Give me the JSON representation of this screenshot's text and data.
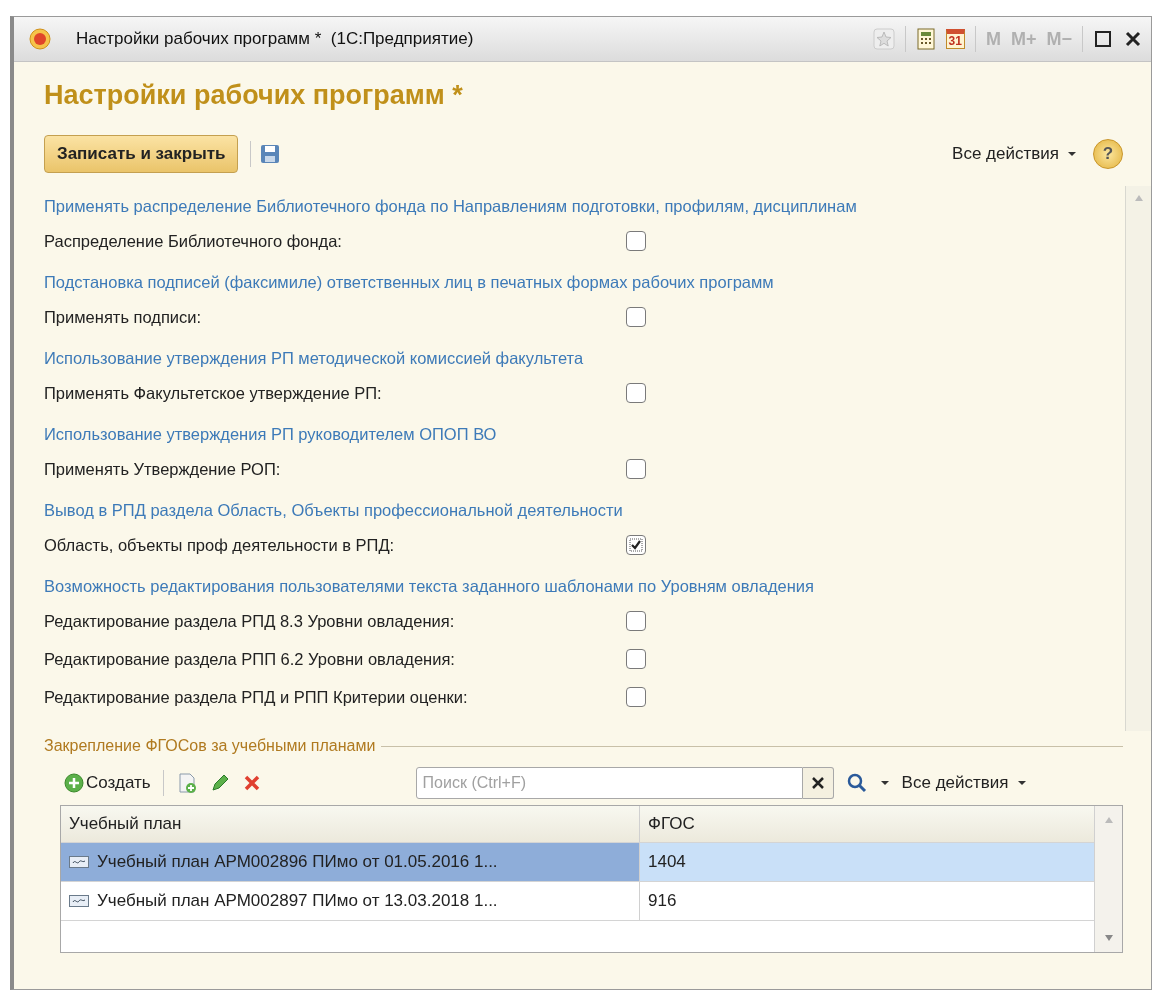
{
  "window": {
    "title": "Настройки рабочих программ *  (1С:Предприятие)",
    "calendar_day": "31",
    "memory_buttons": [
      "M",
      "M+",
      "M−"
    ]
  },
  "form": {
    "title": "Настройки рабочих программ *",
    "save_button": "Записать и закрыть",
    "all_actions": "Все действия",
    "help": "?"
  },
  "settings": [
    {
      "kind": "section",
      "text": "Применять распределение Библиотечного фонда по Направлениям подготовки, профилям, дисциплинам"
    },
    {
      "kind": "checkbox",
      "label": "Распределение Библиотечного фонда:",
      "checked": false
    },
    {
      "kind": "section",
      "text": "Подстановка подписей (факсимиле) ответственных лиц в печатных формах рабочих программ"
    },
    {
      "kind": "checkbox",
      "label": "Применять подписи:",
      "checked": false
    },
    {
      "kind": "section",
      "text": "Использование утверждения  РП методической комиссией факультета"
    },
    {
      "kind": "checkbox",
      "label": "Применять Факультетское утверждение РП:",
      "checked": false
    },
    {
      "kind": "section",
      "text": "Использование утверждения  РП руководителем ОПОП ВО"
    },
    {
      "kind": "checkbox",
      "label": "Применять Утверждение РОП:",
      "checked": false
    },
    {
      "kind": "section",
      "text": "Вывод в РПД раздела Область, Объекты профессиональной деятельности"
    },
    {
      "kind": "checkbox",
      "label": "Область, объекты проф деятельности в РПД:",
      "checked": true
    },
    {
      "kind": "section",
      "text": "Возможность редактирования пользователями текста заданного шаблонами по  Уровням овладения"
    },
    {
      "kind": "checkbox",
      "label": "Редактирование раздела РПД  8.3 Уровни овладения:",
      "checked": false
    },
    {
      "kind": "checkbox",
      "label": "Редактирование раздела РПП 6.2 Уровни овладения:",
      "checked": false
    },
    {
      "kind": "checkbox",
      "label": "Редактирование раздела РПД и РПП  Критерии оценки:",
      "checked": false
    }
  ],
  "group": {
    "title": "Закрепление ФГОСов за учебными планами",
    "create_button": "Создать",
    "search": {
      "placeholder": "Поиск (Ctrl+F)"
    },
    "all_actions": "Все действия",
    "table": {
      "columns": [
        "Учебный план",
        "ФГОС"
      ],
      "rows": [
        {
          "cells": [
            "Учебный план АРМ002896 ПИмо от 01.05.2016 1...",
            "1404"
          ],
          "selected": true
        },
        {
          "cells": [
            "Учебный план АРМ002897 ПИмо от 13.03.2018 1...",
            "916"
          ],
          "selected": false
        }
      ]
    }
  }
}
